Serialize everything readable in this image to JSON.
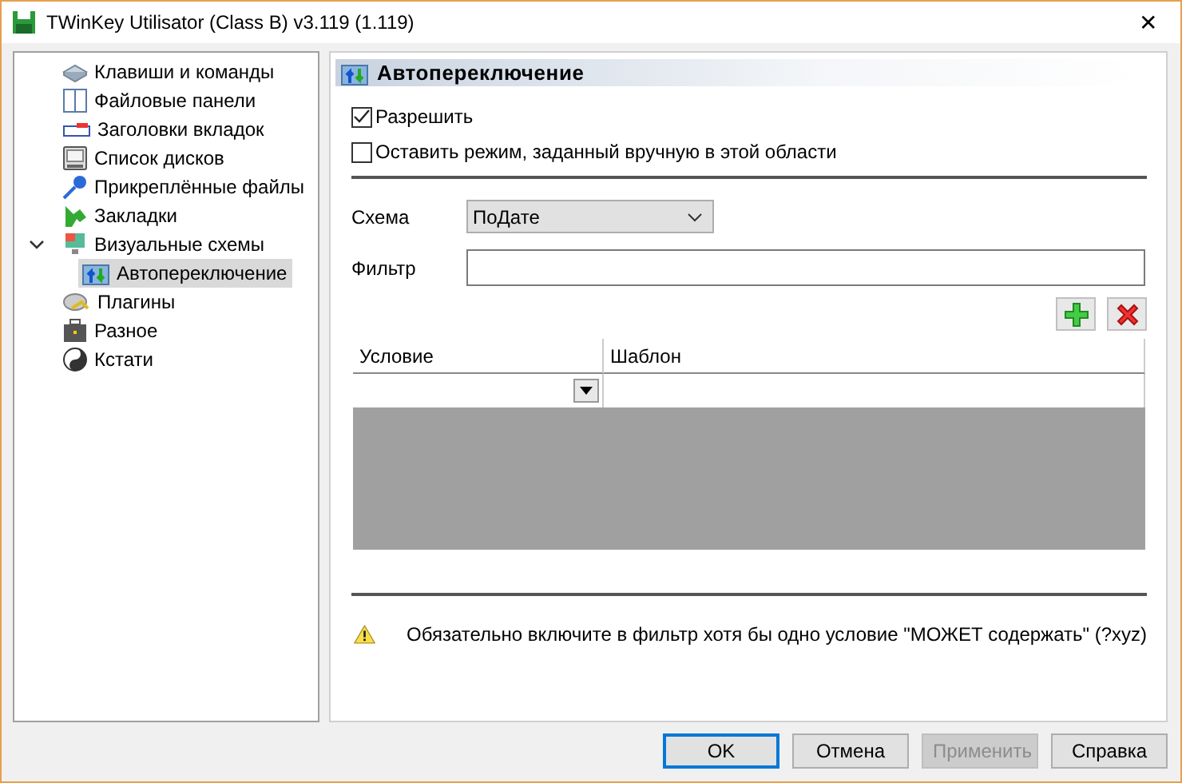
{
  "window": {
    "title": "TWinKey Utilisator (Class B) v3.119 (1.119)",
    "close": "✕"
  },
  "tree": [
    {
      "label": "Клавиши и команды",
      "selected": false
    },
    {
      "label": "Файловые панели",
      "selected": false
    },
    {
      "label": "Заголовки вкладок",
      "selected": false
    },
    {
      "label": "Список дисков",
      "selected": false
    },
    {
      "label": "Прикреплённые файлы",
      "selected": false
    },
    {
      "label": "Закладки",
      "selected": false
    },
    {
      "label": "Визуальные схемы",
      "selected": false,
      "expanded": true,
      "children": [
        {
          "label": "Автопереключение",
          "selected": true
        }
      ]
    },
    {
      "label": "Плагины",
      "selected": false
    },
    {
      "label": "Разное",
      "selected": false
    },
    {
      "label": "Кстати",
      "selected": false
    }
  ],
  "panel": {
    "title": "Автопереключение",
    "checkboxes": [
      {
        "label": "Разрешить",
        "checked": true
      },
      {
        "label": "Оставить режим, заданный вручную в этой области",
        "checked": false
      }
    ],
    "scheme": {
      "label": "Схема",
      "value": "ПоДате"
    },
    "filter": {
      "label": "Фильтр"
    },
    "table": {
      "columns": [
        "Условие",
        "Шаблон"
      ]
    },
    "warning": "Обязательно включите в фильтр хотя бы одно условие \"МОЖЕТ содержать\" (?xyz)"
  },
  "buttons": [
    {
      "label": "OK",
      "default": true,
      "disabled": false
    },
    {
      "label": "Отмена",
      "default": false,
      "disabled": false
    },
    {
      "label": "Применить",
      "default": false,
      "disabled": true
    },
    {
      "label": "Справка",
      "default": false,
      "disabled": false
    }
  ]
}
